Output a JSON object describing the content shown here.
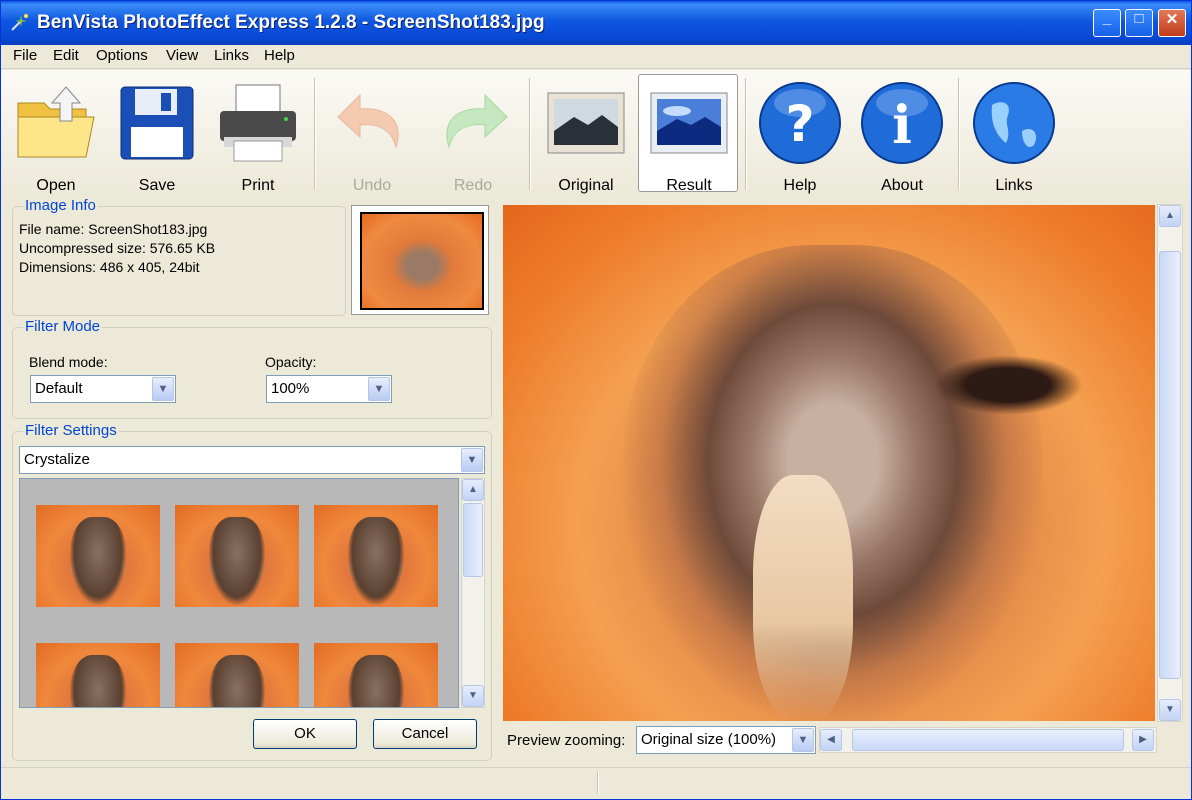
{
  "window": {
    "title": "BenVista PhotoEffect Express 1.2.8 - ScreenShot183.jpg",
    "controls": {
      "minimize": "_",
      "maximize": "□",
      "close": "✕"
    }
  },
  "menu": [
    "File",
    "Edit",
    "Options",
    "View",
    "Links",
    "Help"
  ],
  "toolbar": {
    "open": "Open",
    "save": "Save",
    "print": "Print",
    "undo": "Undo",
    "redo": "Redo",
    "original": "Original",
    "result": "Result",
    "help": "Help",
    "about": "About",
    "links": "Links"
  },
  "image_info": {
    "title": "Image Info",
    "file_name": "File name: ScreenShot183.jpg",
    "uncompressed_size": "Uncompressed size: 576.65 KB",
    "dimensions": "Dimensions: 486 x 405, 24bit"
  },
  "filter_mode": {
    "title": "Filter Mode",
    "blend_label": "Blend mode:",
    "blend_value": "Default",
    "opacity_label": "Opacity:",
    "opacity_value": "100%"
  },
  "filter_settings": {
    "title": "Filter Settings",
    "filter_value": "Crystalize"
  },
  "buttons": {
    "ok": "OK",
    "cancel": "Cancel"
  },
  "preview": {
    "zoom_label": "Preview zooming:",
    "zoom_value": "Original size (100%)"
  },
  "colors": {
    "title_bar": "#0f57e0",
    "accent_text": "#0046d5",
    "preview_orange": "#ee7e2c"
  }
}
